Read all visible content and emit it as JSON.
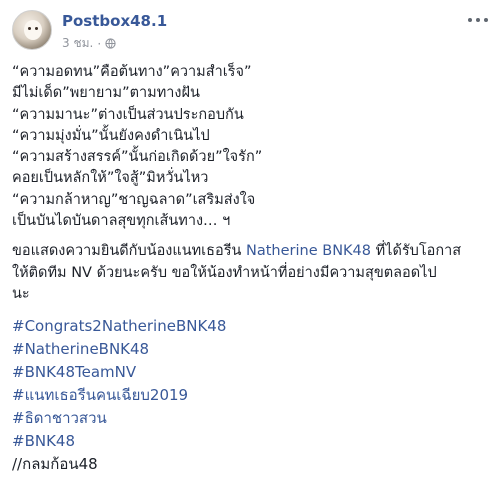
{
  "post": {
    "author": "Postbox48.1",
    "timestamp": "3 ชม.",
    "separator": "·",
    "audience_icon": "globe-icon",
    "more_icon": "more-options-icon",
    "poem_lines": [
      "“ความอดทน”คือต้นทาง”ความสำเร็จ”",
      "มีไม่เด็ด”พยายาม”ตามทางฝัน",
      "“ความมานะ”ต่างเป็นส่วนประกอบกัน",
      "“ความมุ่งมั่น”นั้นยังคงดำเนินไป",
      "“ความสร้างสรรค์”นั้นก่อเกิดด้วย”ใจรัก”",
      "คอยเป็นหลักให้”ใจสู้”มิหวั่นไหว",
      "“ความกล้าหาญ”ชาญฉลาด”เสริมส่งใจ",
      "เป็นบันไดบันดาลสุขทุกเส้นทาง… ฯ"
    ],
    "congrats": {
      "before": "ขอแสดงความยินดีกับน้องแนทเธอรีน ",
      "mention": "Natherine BNK48",
      "after": " ที่ได้รับโอกาส",
      "line2": "ให้ติดทีม NV ด้วยนะครับ ขอให้น้องทำหน้าที่อย่างมีความสุขตลอดไป",
      "line3": "นะ"
    },
    "hashtags": [
      "#Congrats2NatherineBNK48",
      "#NatherineBNK48",
      "#BNK48TeamNV",
      "#แนทเธอรีนคนเฉียบ2019",
      "#ธิดาชาวสวน",
      "#BNK48"
    ],
    "signature": "//กลมก้อน48"
  },
  "colors": {
    "link": "#385898",
    "text": "#1d2129",
    "meta": "#90949c"
  }
}
